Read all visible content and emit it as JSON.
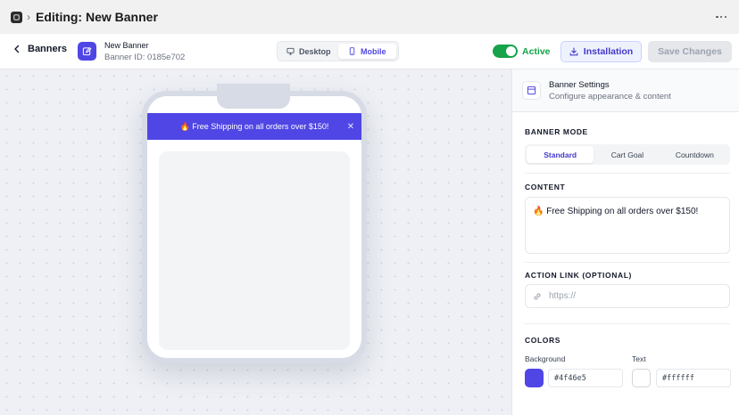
{
  "header": {
    "title": "Editing: New Banner",
    "separator": "›"
  },
  "toolbar": {
    "back_label": "Banners",
    "banner_name": "New Banner",
    "banner_id": "Banner ID: 0185e702",
    "device_options": [
      {
        "label": "Desktop",
        "selected": false
      },
      {
        "label": "Mobile",
        "selected": true
      }
    ],
    "status_label": "Active",
    "status_on": true,
    "installation_label": "Installation",
    "save_label": "Save Changes"
  },
  "preview": {
    "banner_text": "🔥 Free Shipping on all orders over $150!",
    "close_glyph": "✕"
  },
  "settings": {
    "title": "Banner Settings",
    "subtitle": "Configure appearance & content",
    "mode_label": "BANNER MODE",
    "modes": [
      {
        "label": "Standard",
        "selected": true
      },
      {
        "label": "Cart Goal",
        "selected": false
      },
      {
        "label": "Countdown",
        "selected": false
      }
    ],
    "content_label": "CONTENT",
    "content_value": "🔥 Free Shipping on all orders over $150!",
    "action_link_label": "ACTION LINK (OPTIONAL)",
    "action_link_placeholder": "https://",
    "action_link_value": "",
    "colors_label": "COLORS",
    "background_label": "Background",
    "background_value": "#4f46e5",
    "text_label": "Text",
    "text_value": "#ffffff"
  },
  "colors": {
    "accent": "#4f46e5",
    "success": "#16a34a"
  },
  "icons": {
    "app": "app-logo-icon",
    "more": "more-horizontal-icon",
    "back": "chevron-left-icon",
    "edit": "edit-icon",
    "desktop": "monitor-icon",
    "mobile": "smartphone-icon",
    "installation": "download-icon",
    "settings": "layout-icon",
    "link": "link-icon",
    "close": "close-icon"
  }
}
